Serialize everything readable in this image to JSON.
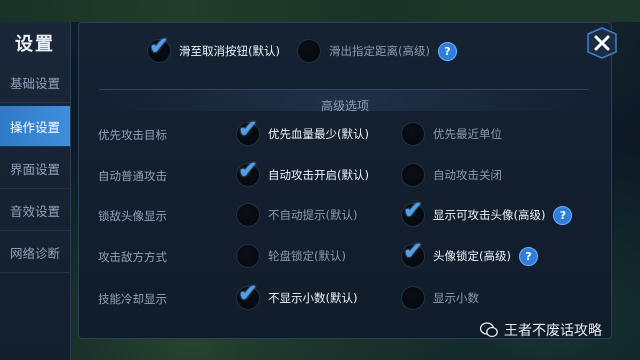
{
  "sidebar": {
    "title": "设置",
    "items": [
      {
        "label": "基础设置",
        "active": false
      },
      {
        "label": "操作设置",
        "active": true
      },
      {
        "label": "界面设置",
        "active": false
      },
      {
        "label": "音效设置",
        "active": false
      },
      {
        "label": "网络诊断",
        "active": false
      }
    ]
  },
  "top_options": [
    {
      "label": "滑至取消按钮(默认)",
      "checked": true
    },
    {
      "label": "滑出指定距离(高级)",
      "checked": false,
      "help": "?"
    }
  ],
  "section_title": "高级选项",
  "settings": [
    {
      "name": "优先攻击目标",
      "options": [
        {
          "label": "优先血量最少(默认)",
          "checked": true
        },
        {
          "label": "优先最近单位",
          "checked": false
        }
      ]
    },
    {
      "name": "自动普通攻击",
      "options": [
        {
          "label": "自动攻击开启(默认)",
          "checked": true
        },
        {
          "label": "自动攻击关闭",
          "checked": false
        }
      ]
    },
    {
      "name": "锁敌头像显示",
      "options": [
        {
          "label": "不自动提示(默认)",
          "checked": false
        },
        {
          "label": "显示可攻击头像(高级)",
          "checked": true,
          "help": "?"
        }
      ]
    },
    {
      "name": "攻击敌方方式",
      "options": [
        {
          "label": "轮盘锁定(默认)",
          "checked": false
        },
        {
          "label": "头像锁定(高级)",
          "checked": true,
          "help": "?"
        }
      ]
    },
    {
      "name": "技能冷却显示",
      "options": [
        {
          "label": "不显示小数(默认)",
          "checked": true
        },
        {
          "label": "显示小数",
          "checked": false
        }
      ]
    }
  ],
  "watermark": "王者不废话攻略",
  "colors": {
    "accent": "#3f8fde",
    "check": "#4ea1f0"
  }
}
